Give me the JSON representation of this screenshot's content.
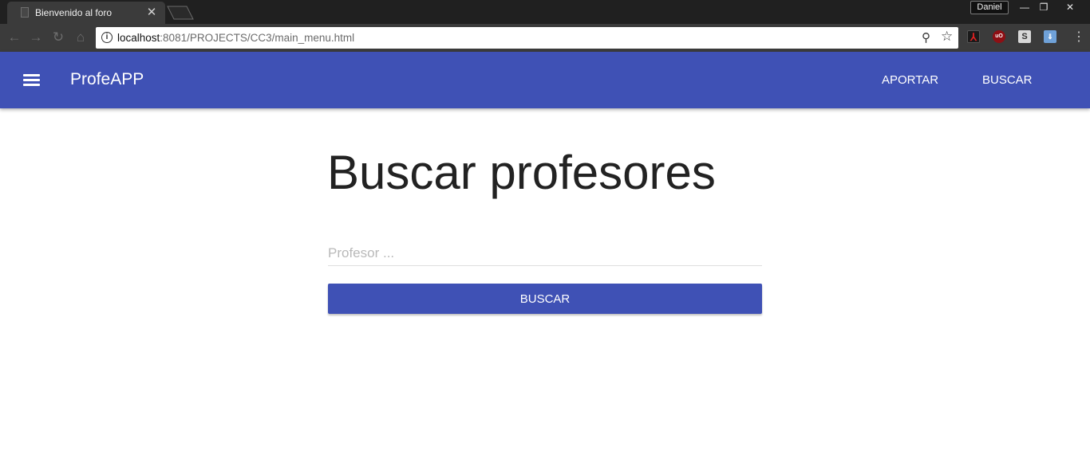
{
  "browser": {
    "tab_title": "Bienvenido al foro",
    "tab_close": "✕",
    "profile_name": "Daniel",
    "window_controls": {
      "minimize": "—",
      "maximize": "❐",
      "close": "✕"
    },
    "url_host": "localhost",
    "url_rest": ":8081/PROJECTS/CC3/main_menu.html",
    "nav_icons": [
      "back-arrow-icon",
      "forward-arrow-icon",
      "reload-icon",
      "home-icon"
    ],
    "extensions": [
      "adobe-pdf-icon",
      "ublock-icon",
      "s-extension-icon",
      "save-extension-icon"
    ]
  },
  "appbar": {
    "title": "ProfeAPP",
    "links": {
      "aportar": "APORTAR",
      "buscar": "BUSCAR"
    },
    "color": "#3f51b5"
  },
  "main": {
    "heading": "Buscar profesores",
    "search": {
      "placeholder": "Profesor ...",
      "value": ""
    },
    "button_label": "BUSCAR"
  }
}
